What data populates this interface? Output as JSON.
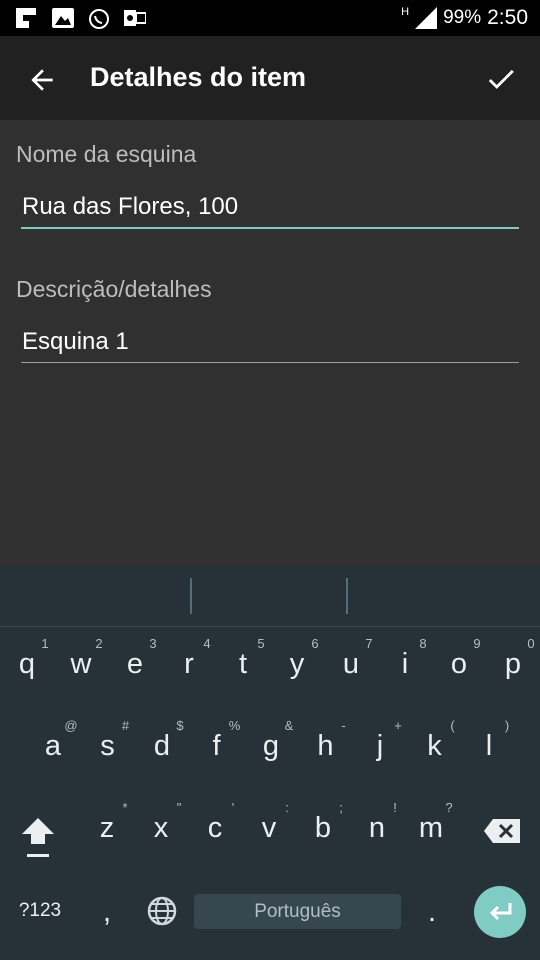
{
  "status_bar": {
    "notification_icons": [
      "flipboard-icon",
      "image-icon",
      "whatsapp-icon",
      "outlook-icon"
    ],
    "network": "H",
    "battery": "99%",
    "time": "2:50"
  },
  "app_bar": {
    "title": "Detalhes do item",
    "back_icon": "arrow-back-icon",
    "confirm_icon": "check-icon"
  },
  "form": {
    "name_field": {
      "label": "Nome da esquina",
      "value": "Rua das Flores, 100",
      "focused": true
    },
    "description_field": {
      "label": "Descrição/detalhes",
      "value": "Esquina 1",
      "focused": false
    }
  },
  "keyboard": {
    "row1": [
      {
        "key": "q",
        "hint": "1"
      },
      {
        "key": "w",
        "hint": "2"
      },
      {
        "key": "e",
        "hint": "3"
      },
      {
        "key": "r",
        "hint": "4"
      },
      {
        "key": "t",
        "hint": "5"
      },
      {
        "key": "y",
        "hint": "6"
      },
      {
        "key": "u",
        "hint": "7"
      },
      {
        "key": "i",
        "hint": "8"
      },
      {
        "key": "o",
        "hint": "9"
      },
      {
        "key": "p",
        "hint": "0"
      }
    ],
    "row2": [
      {
        "key": "a",
        "hint": "@"
      },
      {
        "key": "s",
        "hint": "#"
      },
      {
        "key": "d",
        "hint": "$"
      },
      {
        "key": "f",
        "hint": "%"
      },
      {
        "key": "g",
        "hint": "&"
      },
      {
        "key": "h",
        "hint": "-"
      },
      {
        "key": "j",
        "hint": "+"
      },
      {
        "key": "k",
        "hint": "("
      },
      {
        "key": "l",
        "hint": ")"
      }
    ],
    "row3": [
      {
        "key": "z",
        "hint": "*"
      },
      {
        "key": "x",
        "hint": "\""
      },
      {
        "key": "c",
        "hint": "'"
      },
      {
        "key": "v",
        "hint": ":"
      },
      {
        "key": "b",
        "hint": ";"
      },
      {
        "key": "n",
        "hint": "!"
      },
      {
        "key": "m",
        "hint": "?"
      }
    ],
    "symbols_key": "?123",
    "comma_key": ",",
    "period_key": ".",
    "space_label": "Português",
    "accent_color": "#80cbc4"
  }
}
